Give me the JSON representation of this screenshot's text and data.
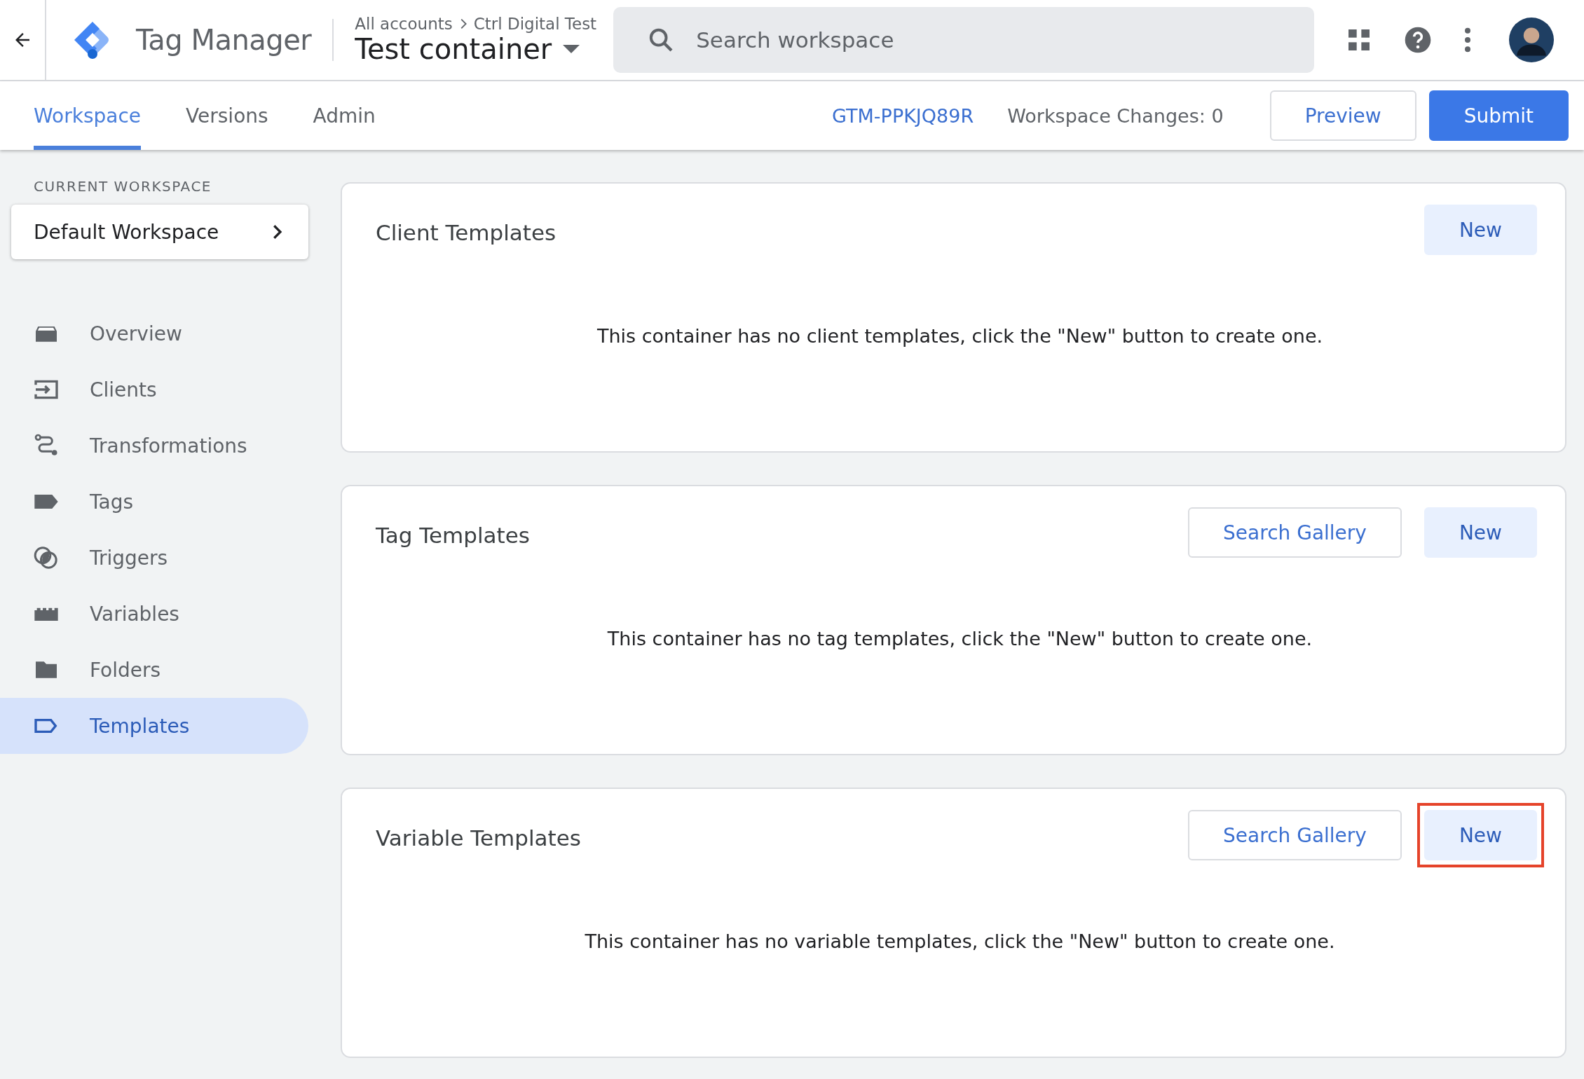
{
  "header": {
    "product": "Tag Manager",
    "breadcrumb": [
      "All accounts",
      "Ctrl Digital Test"
    ],
    "container": "Test container",
    "search": {
      "placeholder": "Search workspace"
    }
  },
  "tabs": [
    {
      "label": "Workspace",
      "selected": true
    },
    {
      "label": "Versions",
      "selected": false
    },
    {
      "label": "Admin",
      "selected": false
    }
  ],
  "toolbar": {
    "container_id": "GTM-PPKJQ89R",
    "changes": "Workspace Changes: 0",
    "buttons": [
      {
        "label": "Preview",
        "kind": "outlined"
      },
      {
        "label": "Submit",
        "kind": "primary"
      }
    ]
  },
  "sidebar": {
    "workspace_heading": "CURRENT WORKSPACE",
    "workspace": "Default Workspace",
    "items": [
      {
        "label": "Overview",
        "selected": false
      },
      {
        "label": "Clients",
        "selected": false
      },
      {
        "label": "Transformations",
        "selected": false
      },
      {
        "label": "Tags",
        "selected": false
      },
      {
        "label": "Triggers",
        "selected": false
      },
      {
        "label": "Variables",
        "selected": false
      },
      {
        "label": "Folders",
        "selected": false
      },
      {
        "label": "Templates",
        "selected": true
      }
    ]
  },
  "cards": [
    {
      "title": "Client Templates",
      "buttons": [
        {
          "label": "New",
          "kind": "tonal",
          "highlighted": false
        }
      ],
      "message": "This container has no client templates, click the \"New\" button to create one."
    },
    {
      "title": "Tag Templates",
      "buttons": [
        {
          "label": "Search Gallery",
          "kind": "outlined",
          "highlighted": false
        },
        {
          "label": "New",
          "kind": "tonal",
          "highlighted": false
        }
      ],
      "message": "This container has no tag templates, click the \"New\" button to create one."
    },
    {
      "title": "Variable Templates",
      "buttons": [
        {
          "label": "Search Gallery",
          "kind": "outlined",
          "highlighted": false
        },
        {
          "label": "New",
          "kind": "tonal",
          "highlighted": true
        }
      ],
      "message": "This container has no variable templates, click the \"New\" button to create one."
    }
  ]
}
